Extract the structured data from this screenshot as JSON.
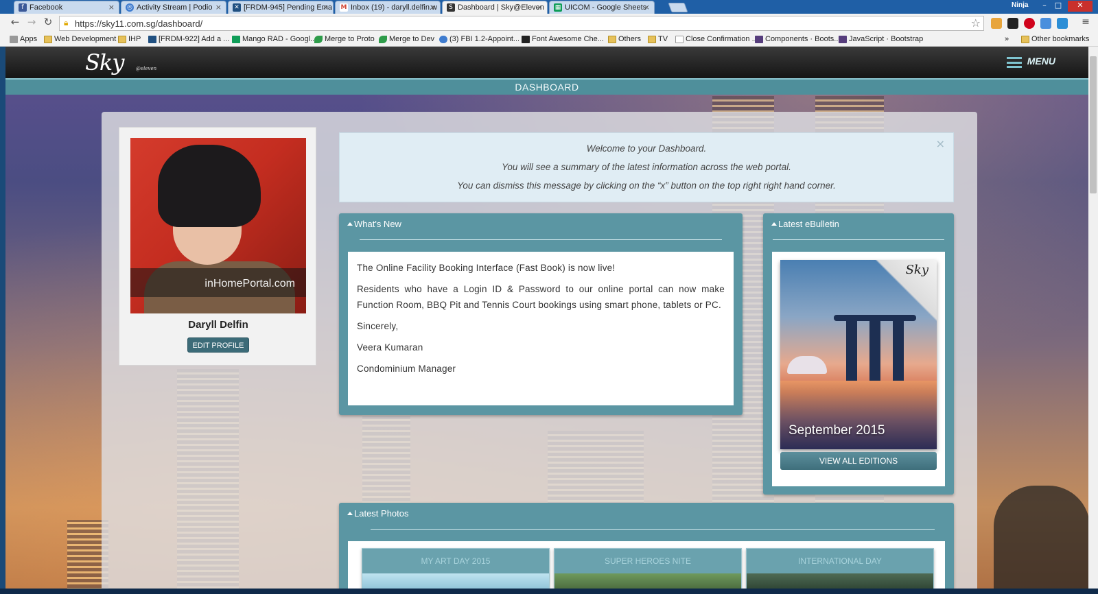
{
  "browser": {
    "tabs": [
      {
        "label": "Facebook",
        "icon": "facebook-icon",
        "color": "#3b5998",
        "active": false
      },
      {
        "label": "Activity Stream | Podio",
        "icon": "podio-icon",
        "color": "#3f7ccf",
        "active": false
      },
      {
        "label": "[FRDM-945] Pending Ema",
        "icon": "jira-icon",
        "color": "#205081",
        "active": false
      },
      {
        "label": "Inbox (19) - daryll.delfin.w",
        "icon": "gmail-icon",
        "color": "#d14836",
        "active": false
      },
      {
        "label": "Dashboard | Sky@Eleven",
        "icon": "sky-icon",
        "color": "#333333",
        "active": true
      },
      {
        "label": "UICOM - Google Sheets",
        "icon": "sheets-icon",
        "color": "#0f9d58",
        "active": false
      }
    ],
    "profile": "Ninja",
    "url": "https://sky11.com.sg/dashboard/",
    "bookmarks": [
      {
        "label": "Apps",
        "icon": "apps-icon"
      },
      {
        "label": "Web Development",
        "icon": "folder-icon"
      },
      {
        "label": "IHP",
        "icon": "folder-icon"
      },
      {
        "label": "[FRDM-922] Add a ...",
        "icon": "jira-icon"
      },
      {
        "label": "Mango RAD - Googl...",
        "icon": "sheets-icon"
      },
      {
        "label": "Merge to Proto",
        "icon": "leaf-icon"
      },
      {
        "label": "Merge to Dev",
        "icon": "leaf-icon"
      },
      {
        "label": "(3) FBI 1.2-Appoint...",
        "icon": "podio-icon"
      },
      {
        "label": "Font Awesome Che...",
        "icon": "flag-icon"
      },
      {
        "label": "Others",
        "icon": "folder-icon"
      },
      {
        "label": "TV",
        "icon": "folder-icon"
      },
      {
        "label": "Close Confirmation ...",
        "icon": "page-icon"
      },
      {
        "label": "Components · Boots...",
        "icon": "bootstrap-icon"
      },
      {
        "label": "JavaScript · Bootstrap",
        "icon": "bootstrap-icon"
      }
    ],
    "overflow": "»",
    "other_bookmarks": "Other bookmarks"
  },
  "site": {
    "logo": "Sky",
    "logo_sub": "@eleven",
    "menu_label": "MENU",
    "page_title": "DASHBOARD",
    "accent": "#5b96a3"
  },
  "profile": {
    "name": "Daryll Delfin",
    "watermark": "inHomePortal.com",
    "edit_label": "EDIT PROFILE"
  },
  "welcome": {
    "lines": [
      "Welcome to your Dashboard.",
      "You will see a summary  of the latest information across the web portal.",
      "You can dismiss this message by clicking on the “x” button on the top right right hand corner."
    ],
    "close": "×"
  },
  "whats_new": {
    "title": "What's New",
    "paragraphs": [
      "The Online Facility Booking Interface (Fast Book) is now live!",
      "Residents who have a Login ID & Password to our online portal can now make Function Room, BBQ Pit and Tennis Court bookings using smart phone, tablets or PC.",
      "Sincerely,",
      "Veera Kumaran",
      "Condominium Manager"
    ]
  },
  "ebulletin": {
    "title": "Latest eBulletin",
    "edition": "September 2015",
    "button": "VIEW ALL EDITIONS"
  },
  "photos": {
    "title": "Latest Photos",
    "albums": [
      "MY ART DAY 2015",
      "SUPER HEROES NITE",
      "INTERNATIONAL DAY"
    ]
  }
}
